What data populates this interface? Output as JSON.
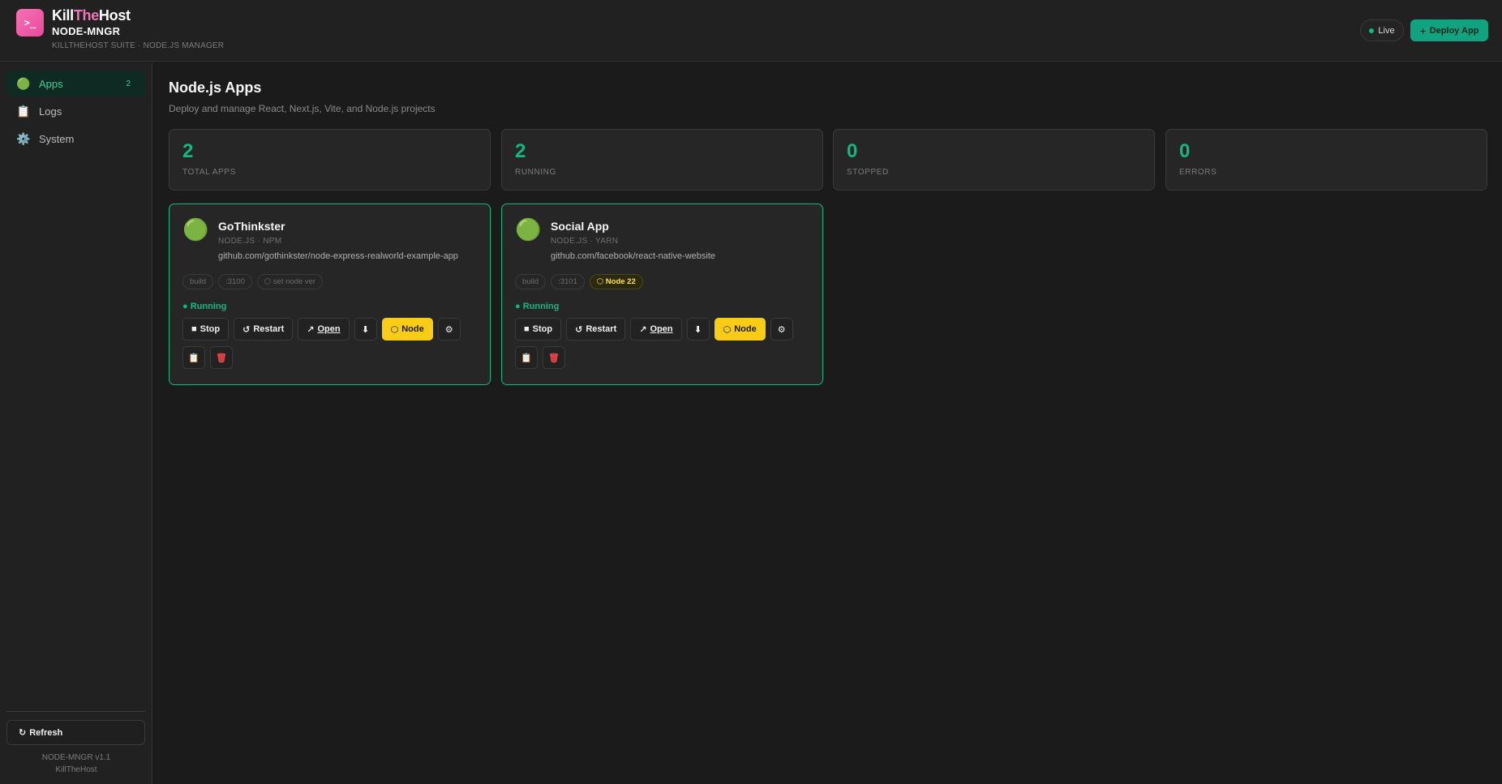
{
  "header": {
    "logo_glyph": ">_",
    "brand_part1": "Kill",
    "brand_part2": "The",
    "brand_part3": "Host",
    "app_name": "NODE-MNGR",
    "app_subtitle": "KILLTHEHOST SUITE · NODE.JS MANAGER",
    "live_label": "Live",
    "deploy_label": "Deploy App",
    "accent_color": "#10b981",
    "brand_color": "#ec4899"
  },
  "sidebar": {
    "items": [
      {
        "icon": "🟢",
        "icon_name": "green-circle-icon",
        "label": "Apps",
        "count": "2"
      },
      {
        "icon": "📋",
        "icon_name": "clipboard-icon",
        "label": "Logs"
      },
      {
        "icon": "⚙️",
        "icon_name": "gear-icon",
        "label": "System"
      }
    ],
    "refresh_label": "Refresh",
    "version": "NODE-MNGR v1.1",
    "author": "KillTheHost"
  },
  "main": {
    "title": "Node.js Apps",
    "subtitle": "Deploy and manage React, Next.js, Vite, and Node.js projects",
    "stats": [
      {
        "value": "2",
        "label": "TOTAL APPS"
      },
      {
        "value": "2",
        "label": "RUNNING"
      },
      {
        "value": "0",
        "label": "STOPPED"
      },
      {
        "value": "0",
        "label": "ERRORS"
      }
    ],
    "apps": [
      {
        "icon": "🟢",
        "name": "GoThinkster",
        "meta": "NODE.JS · NPM",
        "repo": "github.com/gothinkster/node-express-realworld-example-app",
        "tags": [
          "build",
          ":3100",
          "⬡ set node ver"
        ],
        "status": "● Running",
        "buttons": {
          "stop": "Stop",
          "restart": "Restart",
          "open": "Open",
          "node": "Node"
        }
      },
      {
        "icon": "🟢",
        "name": "Social App",
        "meta": "NODE.JS · YARN",
        "repo": "github.com/facebook/react-native-website",
        "tags": [
          "build",
          ":3101",
          "⬡ Node 22"
        ],
        "status": "● Running",
        "buttons": {
          "stop": "Stop",
          "restart": "Restart",
          "open": "Open",
          "node": "Node"
        }
      }
    ]
  }
}
